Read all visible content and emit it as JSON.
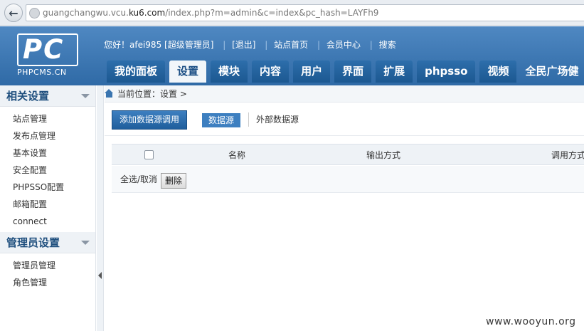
{
  "browser": {
    "url_prefix": "guangchangwu.vcu.",
    "url_host": "ku6.com",
    "url_rest": "/index.php?m=admin&c=index&pc_hash=LAYFh9"
  },
  "logo": {
    "letters": "PC",
    "subtitle": "PHPCMS.CN"
  },
  "topbar": {
    "greeting": "您好！afei985 [超级管理员]",
    "logout": "[退出]",
    "site_home": "站点首页",
    "member_center": "会员中心",
    "search": "搜索"
  },
  "nav": {
    "tabs": [
      "我的面板",
      "设置",
      "模块",
      "内容",
      "用户",
      "界面",
      "扩展",
      "phpsso",
      "视频"
    ],
    "active": "设置",
    "site_name": "全民广场健"
  },
  "sidebar": {
    "group1_title": "相关设置",
    "group1_items": [
      "站点管理",
      "发布点管理",
      "基本设置",
      "安全配置",
      "PHPSSO配置",
      "邮箱配置",
      "connect"
    ],
    "group2_title": "管理员设置",
    "group2_items": [
      "管理员管理",
      "角色管理"
    ]
  },
  "breadcrumb": {
    "text": "当前位置：设置 >"
  },
  "toolbar": {
    "add_button": "添加数据源调用",
    "datasource_button": "数据源",
    "external_link": "外部数据源"
  },
  "table": {
    "headers": {
      "name": "名称",
      "output": "输出方式",
      "call": "调用方式"
    }
  },
  "actions": {
    "select_all": "全选/取消",
    "delete_button": "删除"
  },
  "watermark": "www.wooyun.org",
  "colors": {
    "header_blue": "#3a75b0",
    "tab_blue": "#1f5e98",
    "sidebar_title": "#1f4f7e"
  }
}
